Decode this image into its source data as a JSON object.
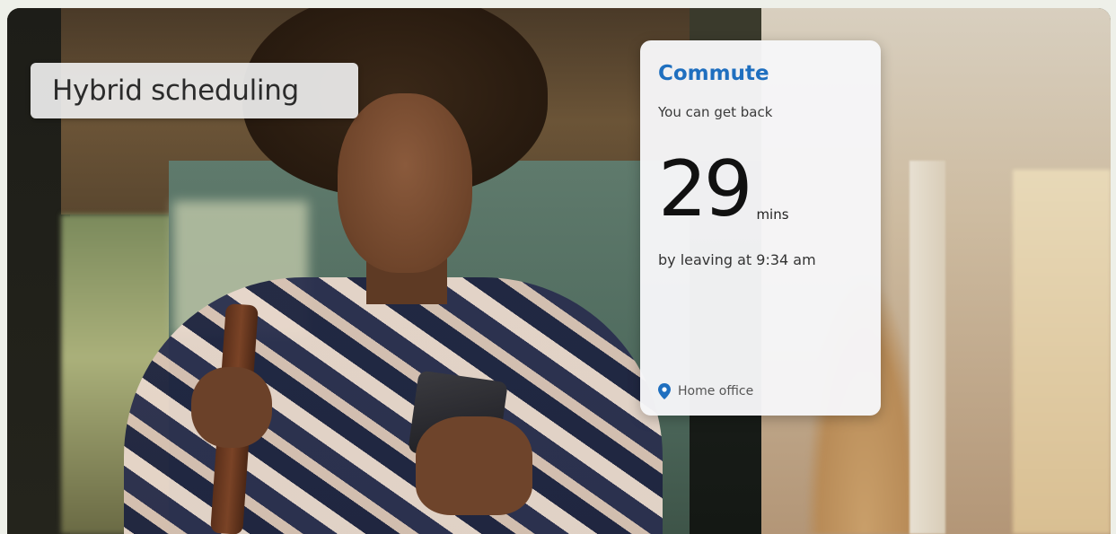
{
  "overlay": {
    "title": "Hybrid scheduling"
  },
  "card": {
    "title": "Commute",
    "subtitle": "You can get back",
    "minutes": "29",
    "unit": "mins",
    "note": "by leaving at 9:34 am",
    "location": "Home office",
    "icon": "location-pin-icon",
    "accent_color": "#1f6fbf"
  }
}
